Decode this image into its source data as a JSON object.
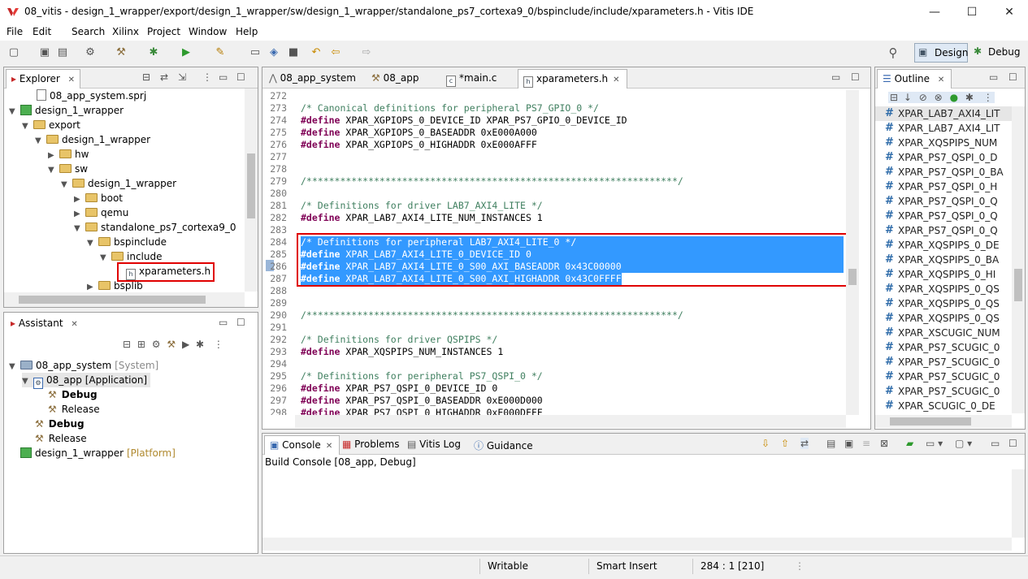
{
  "window": {
    "title": "08_vitis - design_1_wrapper/export/design_1_wrapper/sw/design_1_wrapper/standalone_ps7_cortexa9_0/bspinclude/include/xparameters.h - Vitis IDE",
    "minimize": "—",
    "maximize": "☐",
    "close": "✕"
  },
  "menu": [
    "File",
    "Edit",
    "Search",
    "Xilinx",
    "Project",
    "Window",
    "Help"
  ],
  "perspectives": {
    "design": "Design",
    "debug": "Debug"
  },
  "explorer": {
    "tab": "Explorer",
    "items": [
      {
        "label": "08_app_system.sprj"
      },
      {
        "label": "design_1_wrapper"
      },
      {
        "label": "export"
      },
      {
        "label": "design_1_wrapper"
      },
      {
        "label": "hw"
      },
      {
        "label": "sw"
      },
      {
        "label": "design_1_wrapper"
      },
      {
        "label": "boot"
      },
      {
        "label": "qemu"
      },
      {
        "label": "standalone_ps7_cortexa9_0"
      },
      {
        "label": "bspinclude"
      },
      {
        "label": "include"
      },
      {
        "label": "xparameters.h"
      },
      {
        "label": "bsplib"
      }
    ]
  },
  "assistant": {
    "tab": "Assistant",
    "items": [
      {
        "label": "08_app_system",
        "tag": "[System]"
      },
      {
        "label": "08_app",
        "tag": "[Application]"
      },
      {
        "label": "Debug"
      },
      {
        "label": "Release"
      },
      {
        "label": "Debug"
      },
      {
        "label": "Release"
      },
      {
        "label": "design_1_wrapper",
        "tag": "[Platform]"
      }
    ]
  },
  "editor": {
    "tabs": [
      {
        "label": "08_app_system"
      },
      {
        "label": "08_app"
      },
      {
        "label": "*main.c"
      },
      {
        "label": "xparameters.h"
      }
    ],
    "lines": [
      {
        "n": "272",
        "text": ""
      },
      {
        "n": "273",
        "text": "/* Canonical definitions for peripheral PS7_GPIO_0 */"
      },
      {
        "n": "274",
        "text": "#define XPAR_XGPIOPS_0_DEVICE_ID XPAR_PS7_GPIO_0_DEVICE_ID"
      },
      {
        "n": "275",
        "text": "#define XPAR_XGPIOPS_0_BASEADDR 0xE000A000"
      },
      {
        "n": "276",
        "text": "#define XPAR_XGPIOPS_0_HIGHADDR 0xE000AFFF"
      },
      {
        "n": "277",
        "text": ""
      },
      {
        "n": "278",
        "text": ""
      },
      {
        "n": "279",
        "text": "/******************************************************************/"
      },
      {
        "n": "280",
        "text": ""
      },
      {
        "n": "281",
        "text": "/* Definitions for driver LAB7_AXI4_LITE */"
      },
      {
        "n": "282",
        "text": "#define XPAR_LAB7_AXI4_LITE_NUM_INSTANCES 1"
      },
      {
        "n": "283",
        "text": ""
      },
      {
        "n": "284",
        "text": "/* Definitions for peripheral LAB7_AXI4_LITE_0 */"
      },
      {
        "n": "285",
        "text": "#define XPAR_LAB7_AXI4_LITE_0_DEVICE_ID 0"
      },
      {
        "n": "286",
        "text": "#define XPAR_LAB7_AXI4_LITE_0_S00_AXI_BASEADDR 0x43C00000"
      },
      {
        "n": "287",
        "text": "#define XPAR_LAB7_AXI4_LITE_0_S00_AXI_HIGHADDR 0x43C0FFFF"
      },
      {
        "n": "288",
        "text": ""
      },
      {
        "n": "289",
        "text": ""
      },
      {
        "n": "290",
        "text": "/******************************************************************/"
      },
      {
        "n": "291",
        "text": ""
      },
      {
        "n": "292",
        "text": "/* Definitions for driver QSPIPS */"
      },
      {
        "n": "293",
        "text": "#define XPAR_XQSPIPS_NUM_INSTANCES 1"
      },
      {
        "n": "294",
        "text": ""
      },
      {
        "n": "295",
        "text": "/* Definitions for peripheral PS7_QSPI_0 */"
      },
      {
        "n": "296",
        "text": "#define XPAR_PS7_QSPI_0_DEVICE_ID 0"
      },
      {
        "n": "297",
        "text": "#define XPAR_PS7_QSPI_0_BASEADDR 0xE000D000"
      },
      {
        "n": "298",
        "text": "#define XPAR_PS7_QSPI_0_HIGHADDR 0xE000DFFF"
      }
    ]
  },
  "outline": {
    "tab": "Outline",
    "items": [
      "XPAR_LAB7_AXI4_LIT",
      "XPAR_LAB7_AXI4_LIT",
      "XPAR_XQSPIPS_NUM",
      "XPAR_PS7_QSPI_0_D",
      "XPAR_PS7_QSPI_0_BA",
      "XPAR_PS7_QSPI_0_H",
      "XPAR_PS7_QSPI_0_Q",
      "XPAR_PS7_QSPI_0_Q",
      "XPAR_PS7_QSPI_0_Q",
      "XPAR_XQSPIPS_0_DE",
      "XPAR_XQSPIPS_0_BA",
      "XPAR_XQSPIPS_0_HI",
      "XPAR_XQSPIPS_0_QS",
      "XPAR_XQSPIPS_0_QS",
      "XPAR_XQSPIPS_0_QS",
      "XPAR_XSCUGIC_NUM",
      "XPAR_PS7_SCUGIC_0",
      "XPAR_PS7_SCUGIC_0",
      "XPAR_PS7_SCUGIC_0",
      "XPAR_PS7_SCUGIC_0",
      "XPAR_SCUGIC_0_DE"
    ]
  },
  "console": {
    "tabs": [
      {
        "label": "Console"
      },
      {
        "label": "Problems"
      },
      {
        "label": "Vitis Log"
      },
      {
        "label": "Guidance"
      }
    ],
    "header": "Build Console [08_app, Debug]"
  },
  "status": {
    "writable": "Writable",
    "insert": "Smart Insert",
    "position": "284 : 1 [210]"
  }
}
